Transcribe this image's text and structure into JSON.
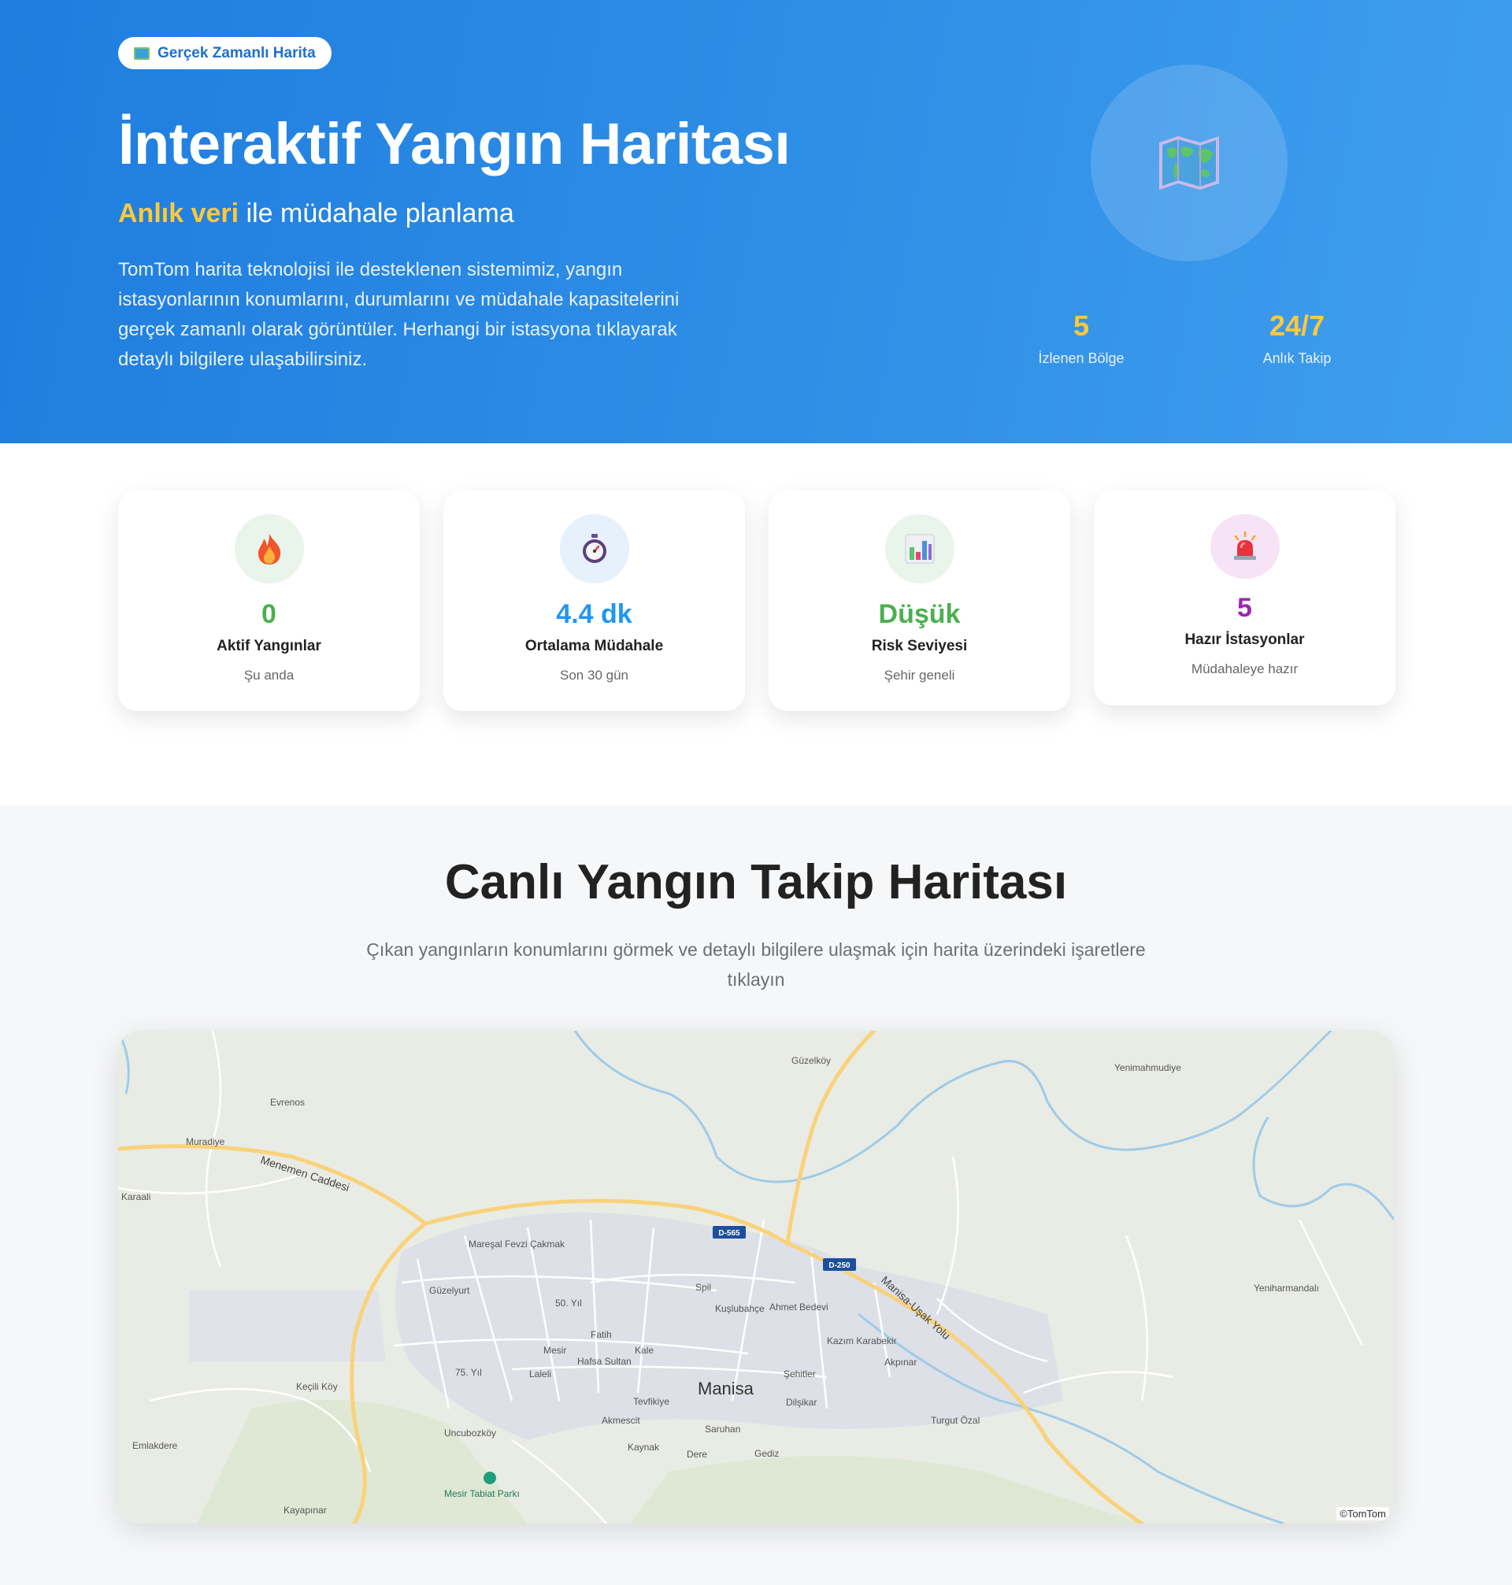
{
  "hero": {
    "badge_label": "Gerçek Zamanlı Harita",
    "badge_icon": "map-icon",
    "title": "İnteraktif Yangın Haritası",
    "subtitle_highlight": "Anlık veri",
    "subtitle_rest": "ile müdahale planlama",
    "description": "TomTom harita teknolojisi ile desteklenen sistemimiz, yangın istasyonlarının konumlarını, durumlarını ve müdahale kapasitelerini gerçek zamanlı olarak görüntüler. Herhangi bir istasyona tıklayarak detaylı bilgilere ulaşabilirsiniz.",
    "stats": [
      {
        "value": "5",
        "label": "İzlenen Bölge"
      },
      {
        "value": "24/7",
        "label": "Anlık Takip"
      }
    ]
  },
  "cards": [
    {
      "icon": "fire-icon",
      "value": "0",
      "title": "Aktif Yangınlar",
      "subtitle": "Şu anda",
      "color": "#4caf50"
    },
    {
      "icon": "stopwatch-icon",
      "value": "4.4 dk",
      "title": "Ortalama Müdahale",
      "subtitle": "Son 30 gün",
      "color": "#2196f3"
    },
    {
      "icon": "bar-chart-icon",
      "value": "Düşük",
      "title": "Risk Seviyesi",
      "subtitle": "Şehir geneli",
      "color": "#4caf50"
    },
    {
      "icon": "siren-icon",
      "value": "5",
      "title": "Hazır İstasyonlar",
      "subtitle": "Müdahaleye hazır",
      "color": "#9c27b0"
    }
  ],
  "map_section": {
    "title": "Canlı Yangın Takip Haritası",
    "subtitle": "Çıkan yangınların konumlarını görmek ve detaylı bilgilere ulaşmak için harita üzerindeki işaretlere tıklayın",
    "attribution": "©TomTom",
    "labels": {
      "city": "Manisa",
      "guzelkoy": "Güzelköy",
      "yenimahmudiye": "Yenimahmudiye",
      "evrenos": "Evrenos",
      "muradiye": "Muradiye",
      "menemen": "Menemen Caddesi",
      "karaali": "Karaali",
      "maresal": "Mareşal Fevzi Çakmak",
      "d565": "D-565",
      "d250": "D-250",
      "manisa_usak": "Manisa-Uşak Yolu",
      "yeniharmandali": "Yeniharmandalı",
      "guzelyurt": "Güzelyurt",
      "elli_yil": "50. Yıl",
      "spil": "Spil",
      "kuslubahce": "Kuşlubahçe",
      "ahmet_bedevi": "Ahmet Bedevi",
      "kazim": "Kazım Karabekir",
      "akpinar": "Akpınar",
      "fatih": "Fatih",
      "mesir": "Mesir",
      "kale": "Kale",
      "hafsa": "Hafsa Sultan",
      "yetmisbes": "75. Yıl",
      "laleli": "Laleli",
      "sehitler": "Şehitler",
      "keciliköy": "Keçili Köy",
      "tevfikiye": "Tevfikiye",
      "dilsikar": "Dilşikar",
      "turgut": "Turgut Özal",
      "akmescit": "Akmescit",
      "saruhan": "Saruhan",
      "uncubozkoy": "Uncubozköy",
      "emlakdere": "Emlakdere",
      "kaynak": "Kaynak",
      "dere": "Dere",
      "gediz": "Gediz",
      "mesir_park": "Mesir Tabiat Parkı",
      "kayapinar": "Kayapınar"
    }
  }
}
